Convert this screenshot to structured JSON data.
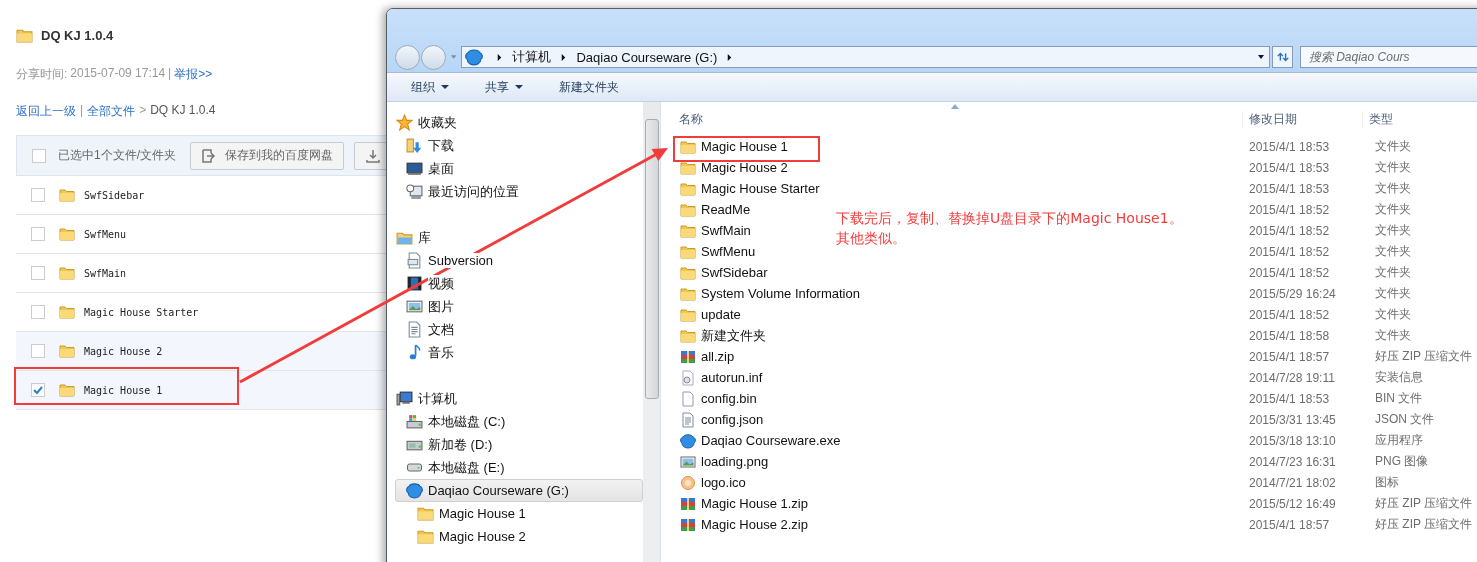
{
  "share_page": {
    "title": "DQ KJ 1.0.4",
    "share_label": "分享时间:",
    "share_time": "2015-07-09 17:14",
    "separator": "|",
    "report_link": "举报>>",
    "breadcrumb": [
      {
        "label": "返回上一级",
        "kind": "link"
      },
      {
        "label": "|",
        "kind": "separator"
      },
      {
        "label": "全部文件",
        "kind": "link"
      },
      {
        "label": ">",
        "kind": "separator"
      },
      {
        "label": "DQ KJ 1.0.4",
        "kind": "current"
      }
    ],
    "toolbar": {
      "select_all_checked": false,
      "selection_text": "已选中1个文件/文件夹",
      "save_button": "保存到我的百度网盘"
    },
    "files": [
      {
        "name": "SwfSidebar",
        "checked": false,
        "hovered": false
      },
      {
        "name": "SwfMenu",
        "checked": false,
        "hovered": false
      },
      {
        "name": "SwfMain",
        "checked": false,
        "hovered": false
      },
      {
        "name": "Magic House Starter",
        "checked": false,
        "hovered": false
      },
      {
        "name": "Magic House 2",
        "checked": false,
        "hovered": true
      },
      {
        "name": "Magic House 1",
        "checked": true,
        "hovered": true
      }
    ]
  },
  "explorer": {
    "address": [
      "计算机",
      "Daqiao Courseware (G:)"
    ],
    "search": {
      "placeholder": "搜索 Daqiao Cours"
    },
    "toolbar": [
      {
        "label": "组织",
        "dropdown": true
      },
      {
        "label": "共享",
        "dropdown": true
      },
      {
        "label": "新建文件夹",
        "dropdown": false
      }
    ],
    "nav": [
      {
        "label": "收藏夹",
        "kind": "star",
        "selected": false,
        "children": [
          {
            "label": "下载",
            "kind": "download",
            "selected": false
          },
          {
            "label": "桌面",
            "kind": "desktop",
            "selected": false
          },
          {
            "label": "最近访问的位置",
            "kind": "recent",
            "selected": false
          }
        ]
      },
      {
        "label": "库",
        "kind": "library",
        "selected": false,
        "children": [
          {
            "label": "Subversion",
            "kind": "document",
            "selected": false
          },
          {
            "label": "视频",
            "kind": "video",
            "selected": false
          },
          {
            "label": "图片",
            "kind": "picture",
            "selected": false
          },
          {
            "label": "文档",
            "kind": "text",
            "selected": false
          },
          {
            "label": "音乐",
            "kind": "music",
            "selected": false
          }
        ]
      },
      {
        "label": "计算机",
        "kind": "computer",
        "selected": false,
        "children": [
          {
            "label": "本地磁盘 (C:)",
            "kind": "drive-win",
            "selected": false
          },
          {
            "label": "新加卷 (D:)",
            "kind": "drive",
            "selected": false
          },
          {
            "label": "本地磁盘 (E:)",
            "kind": "hdd",
            "selected": false
          },
          {
            "label": "Daqiao Courseware (G:)",
            "kind": "mascot",
            "selected": true,
            "children": [
              {
                "label": "Magic House 1",
                "kind": "folder",
                "selected": false
              },
              {
                "label": "Magic House 2",
                "kind": "folder",
                "selected": false
              }
            ]
          }
        ]
      }
    ],
    "columns": [
      "名称",
      "修改日期",
      "类型"
    ],
    "files": [
      {
        "name": "Magic House 1",
        "date": "2015/4/1 18:53",
        "type": "文件夹",
        "kind": "folder"
      },
      {
        "name": "Magic House 2",
        "date": "2015/4/1 18:53",
        "type": "文件夹",
        "kind": "folder"
      },
      {
        "name": "Magic House Starter",
        "date": "2015/4/1 18:53",
        "type": "文件夹",
        "kind": "folder"
      },
      {
        "name": "ReadMe",
        "date": "2015/4/1 18:52",
        "type": "文件夹",
        "kind": "folder"
      },
      {
        "name": "SwfMain",
        "date": "2015/4/1 18:52",
        "type": "文件夹",
        "kind": "folder"
      },
      {
        "name": "SwfMenu",
        "date": "2015/4/1 18:52",
        "type": "文件夹",
        "kind": "folder"
      },
      {
        "name": "SwfSidebar",
        "date": "2015/4/1 18:52",
        "type": "文件夹",
        "kind": "folder"
      },
      {
        "name": "System Volume Information",
        "date": "2015/5/29 16:24",
        "type": "文件夹",
        "kind": "folder"
      },
      {
        "name": "update",
        "date": "2015/4/1 18:52",
        "type": "文件夹",
        "kind": "folder"
      },
      {
        "name": "新建文件夹",
        "date": "2015/4/1 18:58",
        "type": "文件夹",
        "kind": "folder"
      },
      {
        "name": "all.zip",
        "date": "2015/4/1 18:57",
        "type": "好压 ZIP 压缩文件",
        "kind": "zip"
      },
      {
        "name": "autorun.inf",
        "date": "2014/7/28 19:11",
        "type": "安装信息",
        "kind": "settings"
      },
      {
        "name": "config.bin",
        "date": "2015/4/1 18:53",
        "type": "BIN 文件",
        "kind": "file"
      },
      {
        "name": "config.json",
        "date": "2015/3/31 13:45",
        "type": "JSON 文件",
        "kind": "text"
      },
      {
        "name": "Daqiao Courseware.exe",
        "date": "2015/3/18 13:10",
        "type": "应用程序",
        "kind": "mascot"
      },
      {
        "name": "loading.png",
        "date": "2014/7/23 16:31",
        "type": "PNG 图像",
        "kind": "picture"
      },
      {
        "name": "logo.ico",
        "date": "2014/7/21 18:02",
        "type": "图标",
        "kind": "orb"
      },
      {
        "name": "Magic House 1.zip",
        "date": "2015/5/12 16:49",
        "type": "好压 ZIP 压缩文件",
        "kind": "zip"
      },
      {
        "name": "Magic House 2.zip",
        "date": "2015/4/1 18:57",
        "type": "好压 ZIP 压缩文件",
        "kind": "zip"
      }
    ]
  },
  "annotation": {
    "note_lines": [
      "下载完后，复制、替换掉U盘目录下的Magic House1。",
      "其他类似。"
    ]
  }
}
